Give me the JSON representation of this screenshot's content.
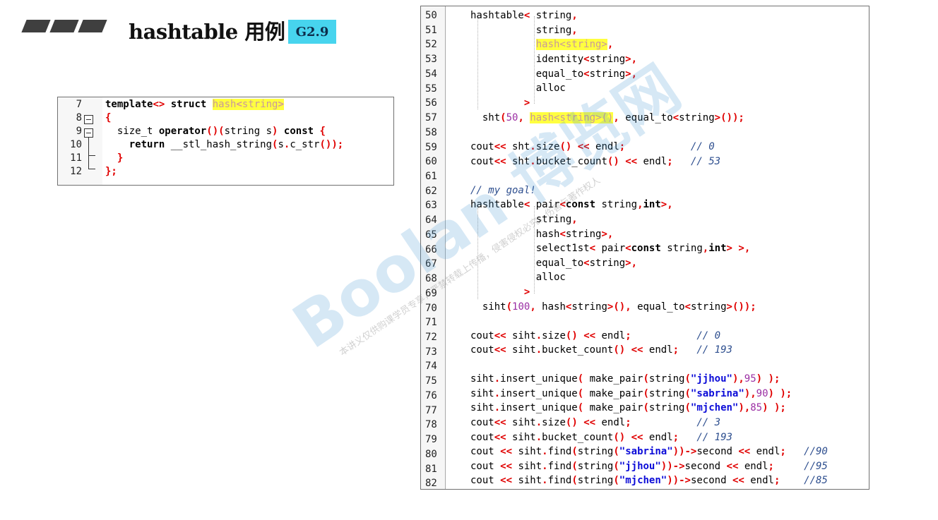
{
  "slide": {
    "title": "hashtable 用例",
    "badge": "G2.9",
    "watermark_main": "Boolan 博览网",
    "watermark_sub": "本讲义仅供购课学员专享，严禁转载上传播，侵害侵权必究，伤害与著作权人"
  },
  "small_panel": {
    "line_numbers": [
      "7",
      "8",
      "9",
      "10",
      "11",
      "12"
    ],
    "lines": [
      "template<> struct hash<string>",
      "{",
      "  size_t operator()(string s) const {",
      "    return __stl_hash_string(s.c_str());",
      "  }",
      "};"
    ]
  },
  "big_panel": {
    "line_numbers": [
      "50",
      "51",
      "52",
      "53",
      "54",
      "55",
      "56",
      "57",
      "58",
      "59",
      "60",
      "61",
      "62",
      "63",
      "64",
      "65",
      "66",
      "67",
      "68",
      "69",
      "70",
      "71",
      "72",
      "73",
      "74",
      "75",
      "76",
      "77",
      "78",
      "79",
      "80",
      "81",
      "82"
    ],
    "lines": [
      "hashtable< string,",
      "           string,",
      "           hash<string>,",
      "           identity<string>,",
      "           equal_to<string>,",
      "           alloc",
      "         >",
      "  sht(50, hash<string>(), equal_to<string>());",
      "",
      "cout<< sht.size() << endl;           // 0",
      "cout<< sht.bucket_count() << endl;   // 53",
      "",
      "// my goal!",
      "hashtable< pair<const string,int>,",
      "           string,",
      "           hash<string>,",
      "           select1st< pair<const string,int> >,",
      "           equal_to<string>,",
      "           alloc",
      "         >",
      "  siht(100, hash<string>(), equal_to<string>());",
      "",
      "cout<< siht.size() << endl;           // 0",
      "cout<< siht.bucket_count() << endl;   // 193",
      "",
      "siht.insert_unique( make_pair(string(\"jjhou\"),95) );",
      "siht.insert_unique( make_pair(string(\"sabrina\"),90) );",
      "siht.insert_unique( make_pair(string(\"mjchen\"),85) );",
      "cout<< siht.size() << endl;           // 3",
      "cout<< siht.bucket_count() << endl;   // 193",
      "cout << siht.find(string(\"sabrina\"))->second << endl;   //90",
      "cout << siht.find(string(\"jjhou\"))->second << endl;     //95",
      "cout << siht.find(string(\"mjchen\"))->second << endl;    //85"
    ]
  }
}
